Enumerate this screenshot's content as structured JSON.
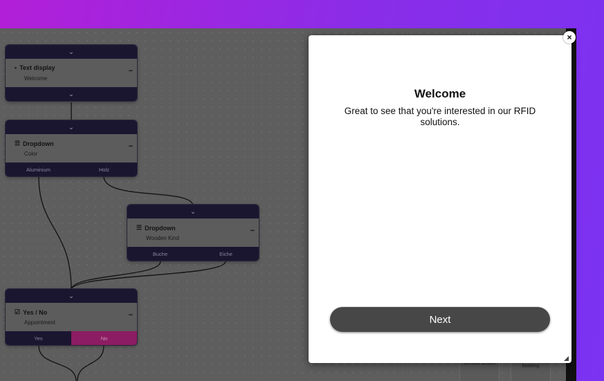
{
  "nodes": [
    {
      "type_label": "Text display",
      "icon": "comment-icon",
      "subtitle": "Welcome"
    },
    {
      "type_label": "Dropdown",
      "icon": "list-icon",
      "subtitle": "Color",
      "options": [
        "Aluminium",
        "Holz"
      ]
    },
    {
      "type_label": "Dropdown",
      "icon": "list-icon",
      "subtitle": "Wooden Kind",
      "options": [
        "Buche",
        "Eiche"
      ]
    },
    {
      "type_label": "Yes / No",
      "icon": "checkbox-icon",
      "subtitle": "Appointment",
      "options": [
        "Yes",
        "No"
      ]
    }
  ],
  "node_menu_label": "...",
  "background_cards": [
    "Contact details",
    "calendar booking"
  ],
  "modal": {
    "title": "Welcome",
    "text": "Great to see that you're interested in our RFID solutions.",
    "next_label": "Next",
    "close_symbol": "×"
  },
  "colors": {
    "gradient_start": "#b21fd8",
    "gradient_end": "#7b33f2",
    "node_bar": "#1b1630",
    "no_option": "#8c1c63",
    "next_button": "#474747"
  }
}
